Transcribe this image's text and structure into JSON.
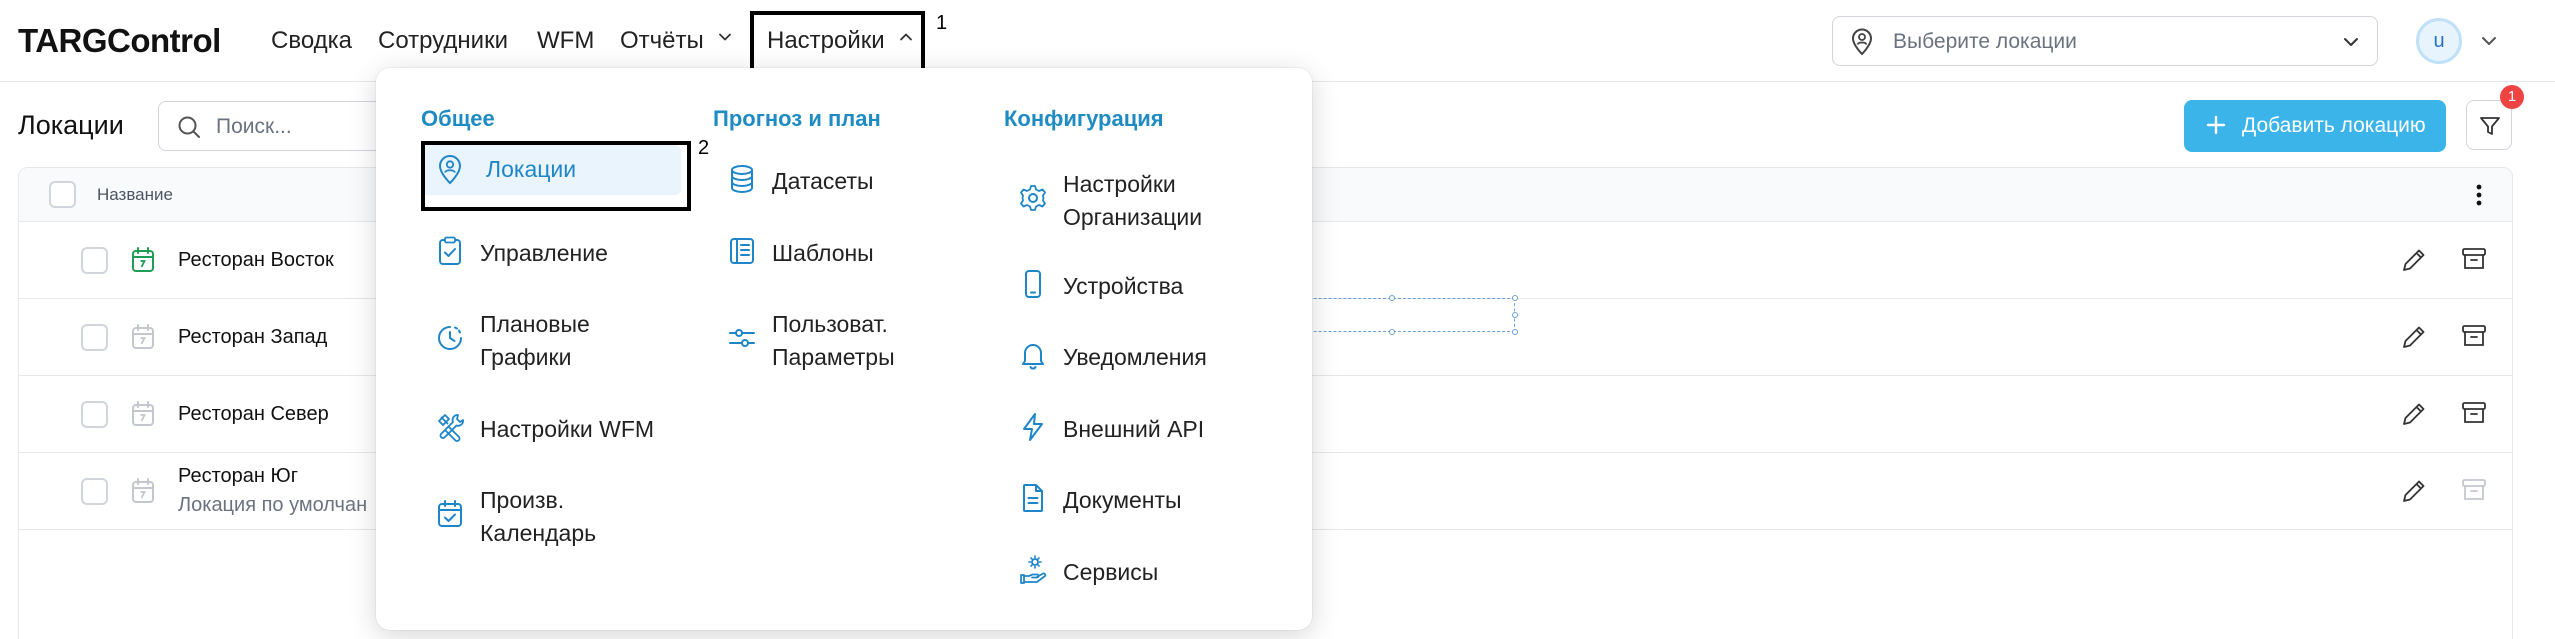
{
  "app": {
    "logo": "TARGControl"
  },
  "topnav": {
    "items": [
      {
        "label": "Сводка"
      },
      {
        "label": "Сотрудники"
      },
      {
        "label": "WFM"
      },
      {
        "label": "Отчёты"
      },
      {
        "label": "Настройки"
      }
    ],
    "location_select": {
      "placeholder": "Выберите локации"
    },
    "user": {
      "initial": "u"
    }
  },
  "annotations": {
    "first": "1",
    "second": "2"
  },
  "page": {
    "title": "Локации",
    "search_placeholder": "Поиск...",
    "add_button": "Добавить локацию",
    "filter_badge": "1"
  },
  "table": {
    "columns": {
      "name": "Название"
    },
    "rows": [
      {
        "name": "Ресторан Восток",
        "subtitle": "",
        "active": true,
        "archive_enabled": true
      },
      {
        "name": "Ресторан Запад",
        "subtitle": "",
        "active": false,
        "archive_enabled": true
      },
      {
        "name": "Ресторан Север",
        "subtitle": "",
        "active": false,
        "archive_enabled": true
      },
      {
        "name": "Ресторан Юг",
        "subtitle": "Локация по умолчан",
        "active": false,
        "archive_enabled": false
      }
    ]
  },
  "menu": {
    "columns": [
      {
        "title": "Общее",
        "items": [
          {
            "label": "Локации",
            "icon": "map-pin-person-icon",
            "active": true
          },
          {
            "label": "Управление",
            "icon": "clipboard-check-icon"
          },
          {
            "label": "Плановые\nГрафики",
            "icon": "clock-history-icon"
          },
          {
            "label": "Настройки WFM",
            "icon": "tools-icon"
          },
          {
            "label": "Произв.\nКалендарь",
            "icon": "calendar-check-icon"
          }
        ]
      },
      {
        "title": "Прогноз и план",
        "items": [
          {
            "label": "Датасеты",
            "icon": "database-icon"
          },
          {
            "label": "Шаблоны",
            "icon": "book-template-icon"
          },
          {
            "label": "Пользоват.\nПараметры",
            "icon": "sliders-icon"
          }
        ]
      },
      {
        "title": "Конфигурация",
        "items": [
          {
            "label": "Настройки\nОрганизации",
            "icon": "gear-icon"
          },
          {
            "label": "Устройства",
            "icon": "smartphone-icon"
          },
          {
            "label": "Уведомления",
            "icon": "bell-icon"
          },
          {
            "label": "Внешний API",
            "icon": "lightning-icon"
          },
          {
            "label": "Документы",
            "icon": "document-icon"
          },
          {
            "label": "Сервисы",
            "icon": "hand-gear-icon"
          }
        ]
      }
    ]
  },
  "colors": {
    "accent": "#1e8bc3",
    "primary_button": "#3bb4ea",
    "badge": "#ef4444",
    "active_calendar": "#1f9d55",
    "inactive_calendar": "#c4c8ce"
  }
}
